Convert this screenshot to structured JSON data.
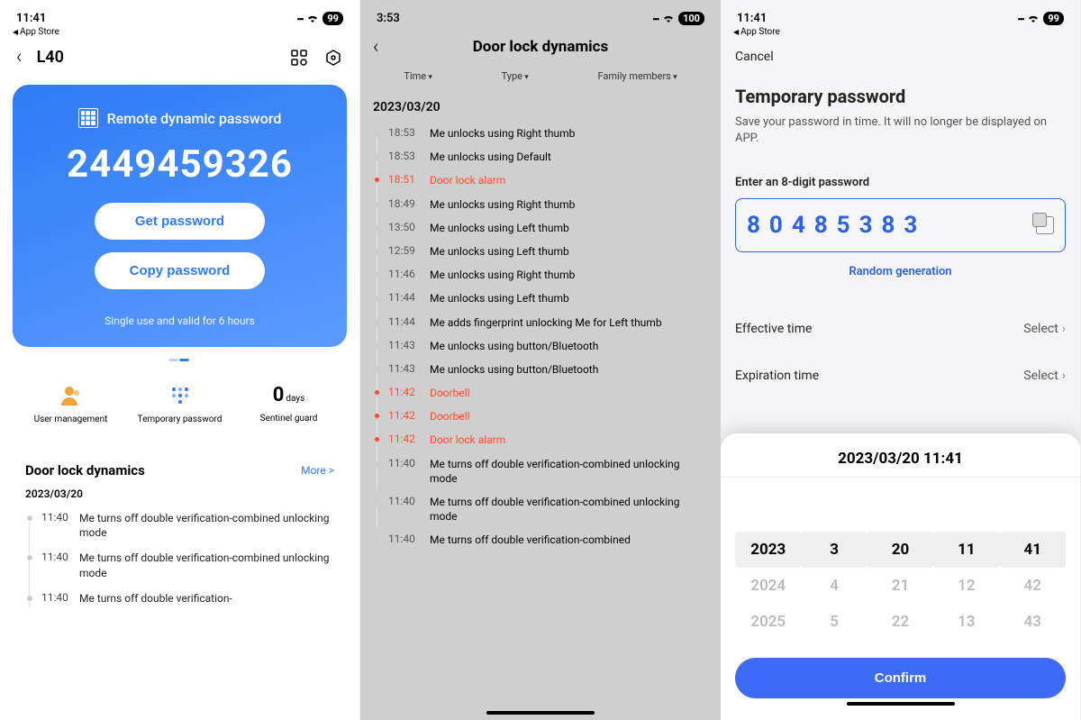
{
  "screen1": {
    "status": {
      "time": "11:41",
      "back_app": "App Store",
      "battery": "99"
    },
    "nav": {
      "title": "L40"
    },
    "card": {
      "title": "Remote dynamic password",
      "code": "2449459326",
      "get_btn": "Get password",
      "copy_btn": "Copy password",
      "footer": "Single use and valid for 6 hours"
    },
    "menu": {
      "user_mgmt": "User management",
      "temp_pw": "Temporary password",
      "sentinel_value": "0",
      "sentinel_unit": "days",
      "sentinel_label": "Sentinel guard"
    },
    "dynamics": {
      "title": "Door lock dynamics",
      "more": "More >",
      "date": "2023/03/20",
      "rows": [
        {
          "time": "11:40",
          "msg": "Me turns off double verification-combined unlocking mode"
        },
        {
          "time": "11:40",
          "msg": "Me turns off double verification-combined unlocking mode"
        },
        {
          "time": "11:40",
          "msg": "Me turns off double verification-"
        }
      ]
    }
  },
  "screen2": {
    "status": {
      "time": "3:53",
      "battery": "100"
    },
    "title": "Door lock dynamics",
    "filters": {
      "time": "Time",
      "type": "Type",
      "family": "Family members"
    },
    "date": "2023/03/20",
    "rows": [
      {
        "time": "18:53",
        "msg": "Me unlocks using  Right thumb",
        "alarm": false
      },
      {
        "time": "18:53",
        "msg": "Me unlocks using Default",
        "alarm": false
      },
      {
        "time": "18:51",
        "msg": "Door lock alarm",
        "alarm": true
      },
      {
        "time": "18:49",
        "msg": "Me unlocks using  Right thumb",
        "alarm": false
      },
      {
        "time": "13:50",
        "msg": "Me unlocks using  Left thumb",
        "alarm": false
      },
      {
        "time": "12:59",
        "msg": "Me unlocks using  Left thumb",
        "alarm": false
      },
      {
        "time": "11:46",
        "msg": "Me unlocks using  Right thumb",
        "alarm": false
      },
      {
        "time": "11:44",
        "msg": "Me unlocks using  Left thumb",
        "alarm": false
      },
      {
        "time": "11:44",
        "msg": "Me adds fingerprint unlocking Me for Left thumb",
        "alarm": false
      },
      {
        "time": "11:43",
        "msg": "Me unlocks using button/Bluetooth",
        "alarm": false
      },
      {
        "time": "11:43",
        "msg": "Me unlocks using button/Bluetooth",
        "alarm": false
      },
      {
        "time": "11:42",
        "msg": "Doorbell",
        "alarm": true
      },
      {
        "time": "11:42",
        "msg": "Doorbell",
        "alarm": true
      },
      {
        "time": "11:42",
        "msg": "Door lock alarm",
        "alarm": true
      },
      {
        "time": "11:40",
        "msg": "Me turns off double verification-combined unlocking mode",
        "alarm": false
      },
      {
        "time": "11:40",
        "msg": "Me turns off double verification-combined unlocking mode",
        "alarm": false
      },
      {
        "time": "11:40",
        "msg": "Me turns off double verification-combined",
        "alarm": false
      }
    ]
  },
  "screen3": {
    "status": {
      "time": "11:41",
      "back_app": "App Store",
      "battery": "99"
    },
    "cancel": "Cancel",
    "title": "Temporary password",
    "subtitle": "Save your password in time. It will no longer be displayed on APP.",
    "pw_label": "Enter an 8-digit password",
    "pw_value": "80485383",
    "random": "Random generation",
    "effective": {
      "label": "Effective time",
      "value": "Select"
    },
    "expiration": {
      "label": "Expiration time",
      "value": "Select"
    },
    "sheet": {
      "title": "2023/03/20 11:41",
      "cols": [
        {
          "selected": "2023",
          "next": [
            "2024",
            "2025"
          ]
        },
        {
          "selected": "3",
          "next": [
            "4",
            "5"
          ]
        },
        {
          "selected": "20",
          "next": [
            "21",
            "22"
          ]
        },
        {
          "selected": "11",
          "next": [
            "12",
            "13"
          ]
        },
        {
          "selected": "41",
          "next": [
            "42",
            "43"
          ]
        }
      ],
      "confirm": "Confirm"
    }
  }
}
